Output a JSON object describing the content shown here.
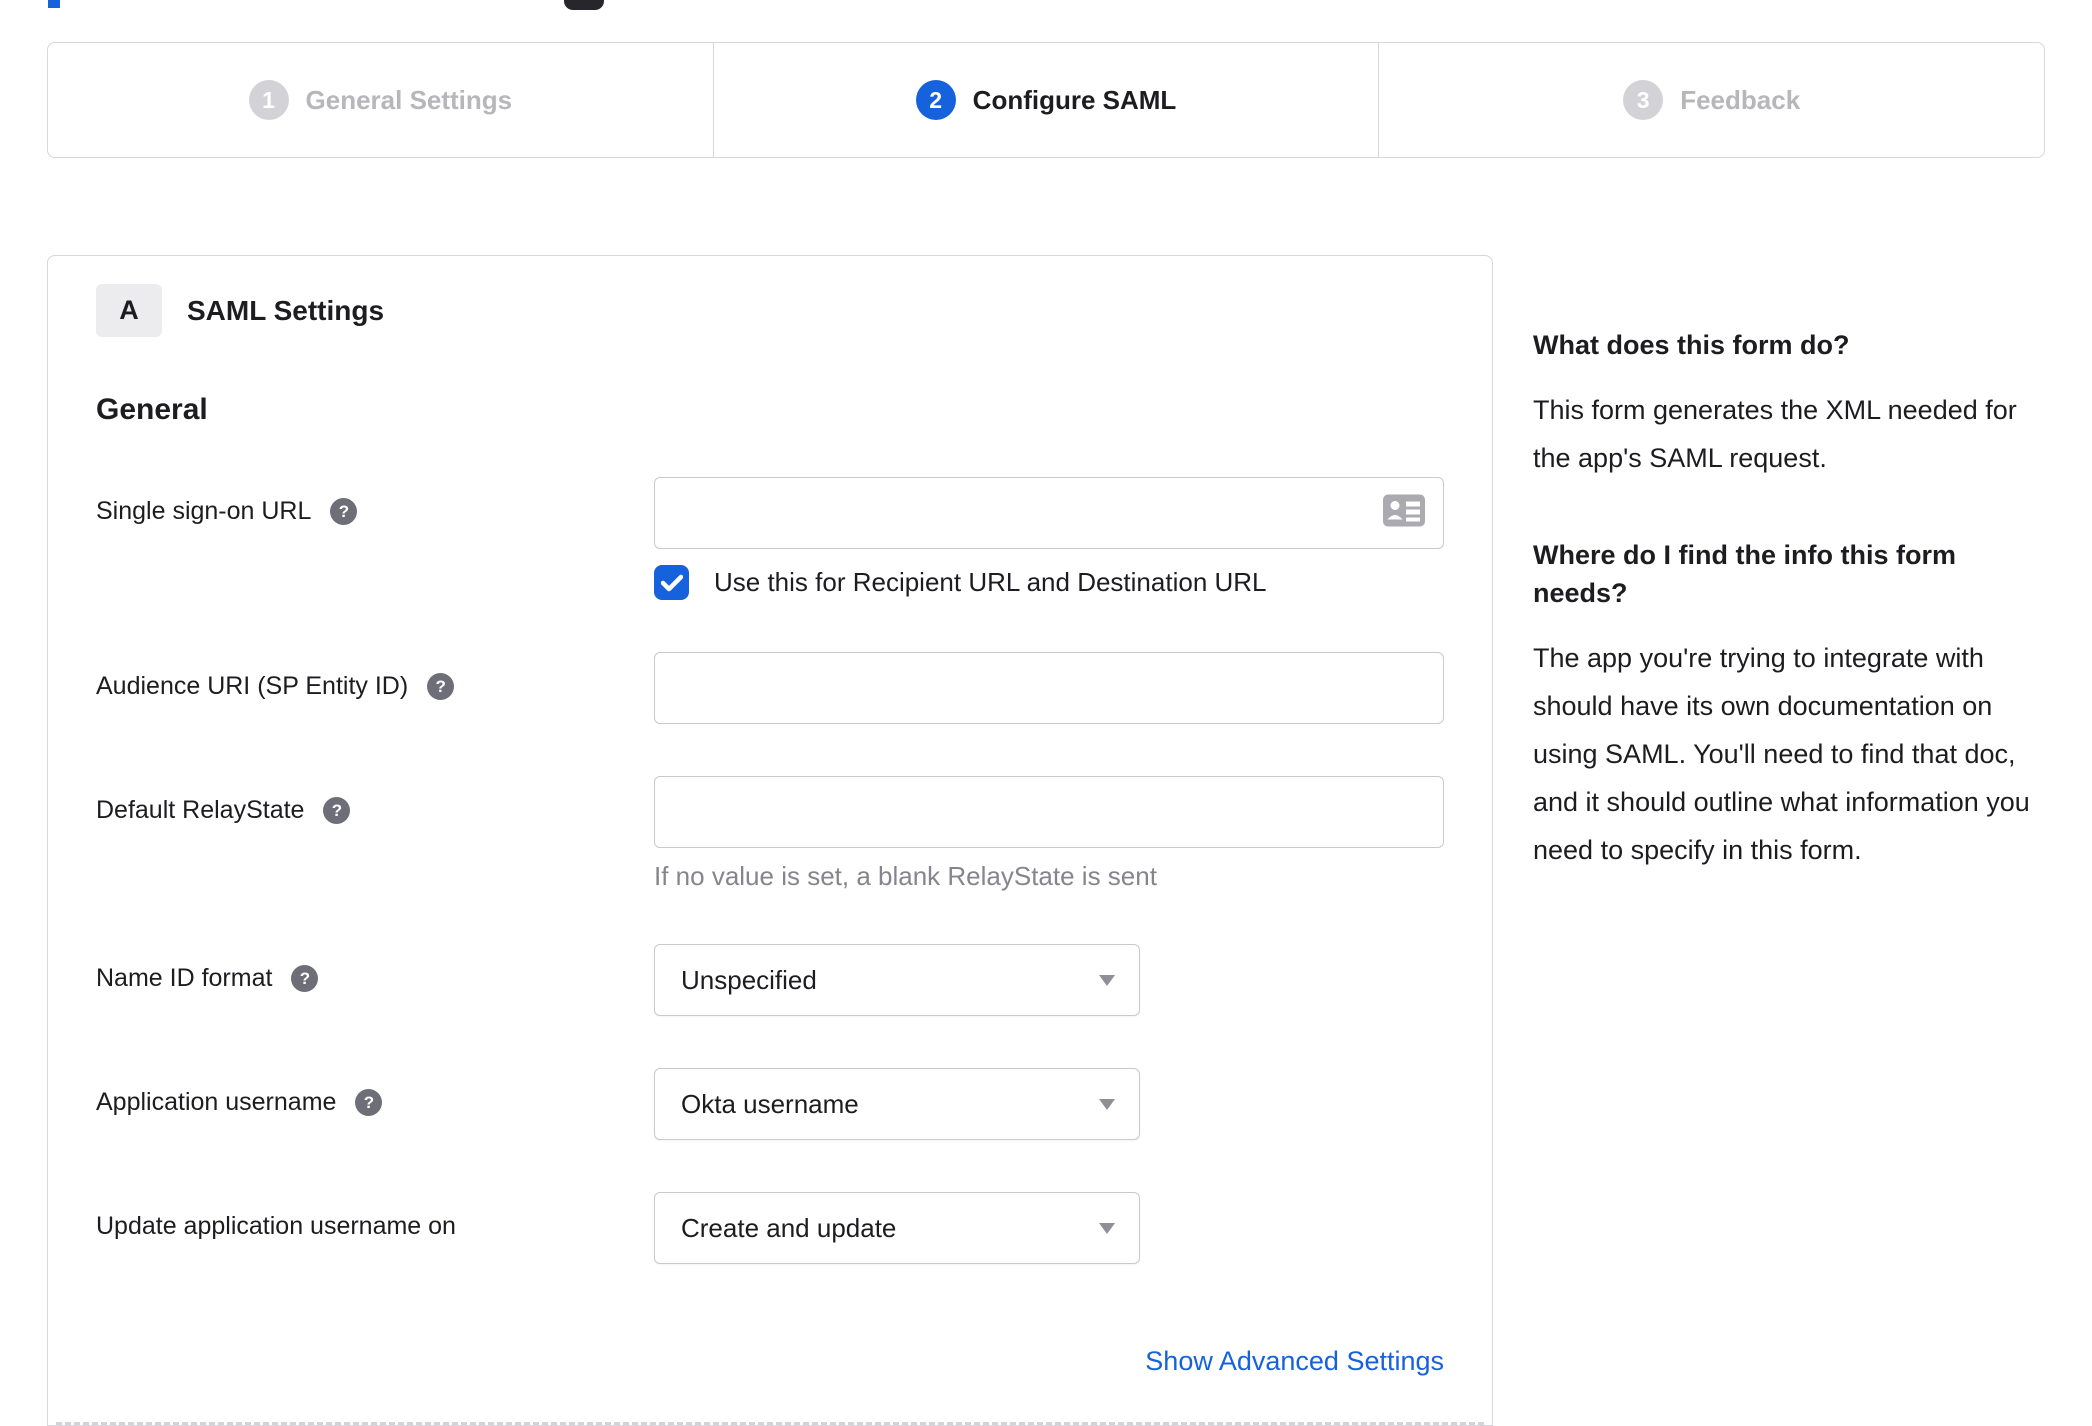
{
  "stepper": {
    "steps": [
      {
        "number": "1",
        "label": "General Settings",
        "state": "inactive"
      },
      {
        "number": "2",
        "label": "Configure SAML",
        "state": "active"
      },
      {
        "number": "3",
        "label": "Feedback",
        "state": "inactive"
      }
    ]
  },
  "panel": {
    "section_badge": "A",
    "section_title": "SAML Settings",
    "group_title": "General",
    "fields": {
      "sso_url": {
        "label": "Single sign-on URL",
        "value": "",
        "checkbox_label": "Use this for Recipient URL and Destination URL",
        "checkbox_checked": true
      },
      "audience_uri": {
        "label": "Audience URI (SP Entity ID)",
        "value": ""
      },
      "default_relaystate": {
        "label": "Default RelayState",
        "value": "",
        "helper_text": "If no value is set, a blank RelayState is sent"
      },
      "name_id_format": {
        "label": "Name ID format",
        "value": "Unspecified"
      },
      "application_username": {
        "label": "Application username",
        "value": "Okta username"
      },
      "update_application_username_on": {
        "label": "Update application username on",
        "value": "Create and update"
      }
    },
    "advanced_link_label": "Show Advanced Settings"
  },
  "sidebar": {
    "sections": [
      {
        "heading": "What does this form do?",
        "body": "This form generates the XML needed for the app's SAML request."
      },
      {
        "heading": "Where do I find the info this form needs?",
        "body": "The app you're trying to integrate with should have its own documentation on using SAML. You'll need to find that doc, and it should outline what information you need to specify in this form."
      }
    ]
  },
  "icons": {
    "help": "?",
    "checkbox_check": "check-mark",
    "input_right": "contact-card"
  },
  "colors": {
    "accent_blue": "#1662dd",
    "text_dark": "#1d1d21",
    "inactive_gray": "#b6b6bb",
    "border_gray": "#d7d7dc",
    "helper_gray": "#85858d"
  }
}
